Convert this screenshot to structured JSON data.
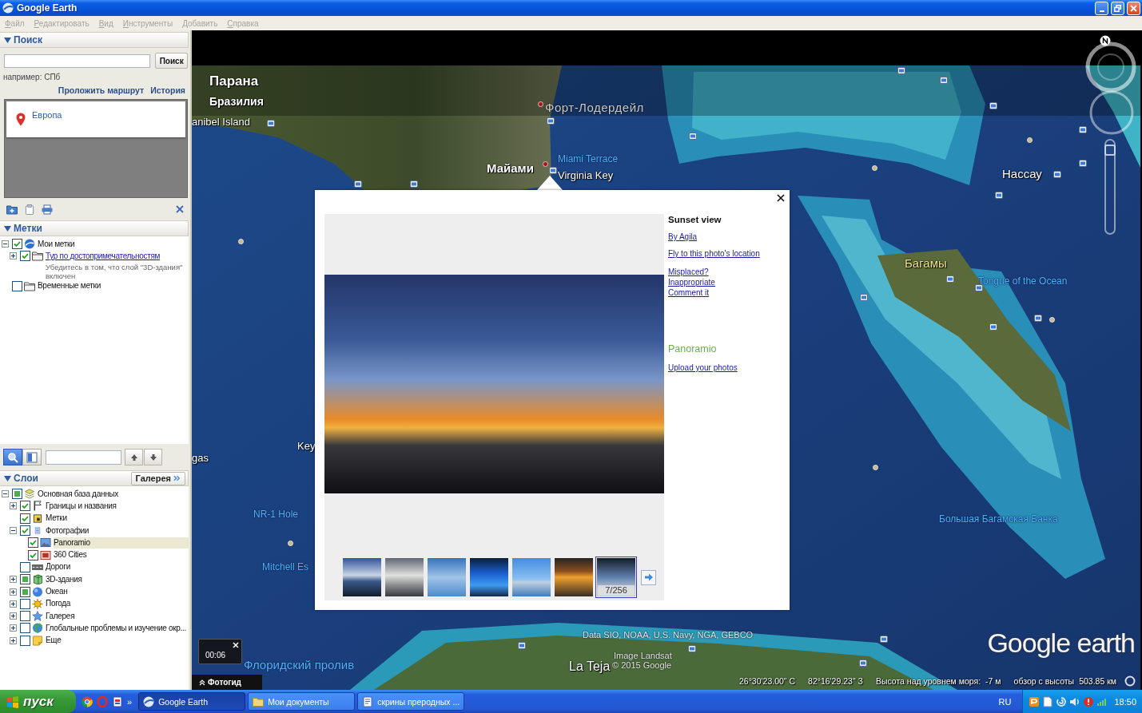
{
  "window": {
    "title": "Google Earth"
  },
  "menu": [
    {
      "label": "Файл",
      "disabled": true
    },
    {
      "label": "Редактировать",
      "disabled": true
    },
    {
      "label": "Вид",
      "disabled": true
    },
    {
      "label": "Инструменты",
      "disabled": true
    },
    {
      "label": "Добавить",
      "disabled": true
    },
    {
      "label": "Справка",
      "disabled": true
    }
  ],
  "search": {
    "title": "Поиск",
    "expanded": true,
    "button": "Поиск",
    "hint": "например: СПб",
    "links": [
      "Проложить маршрут",
      "История"
    ],
    "results": [
      {
        "label": "Европа"
      }
    ]
  },
  "places": {
    "title": "Метки",
    "expanded": true,
    "tree": [
      {
        "label": "Мои метки",
        "kind": "globe",
        "checked": true,
        "partial": false,
        "expandable": true,
        "expanded": true,
        "link": false,
        "selected": false,
        "children": [
          {
            "label": "Тур по достопримечательностям",
            "kind": "folder",
            "checked": true,
            "partial": false,
            "expandable": true,
            "expanded": false,
            "link": true,
            "selected": false,
            "description": "Убедитесь в том, что слой \"3D-здания\" включен"
          }
        ]
      },
      {
        "label": "Временные метки",
        "kind": "folder",
        "checked": false,
        "partial": false,
        "expandable": false,
        "link": false,
        "selected": false
      }
    ]
  },
  "layers": {
    "title": "Слои",
    "expanded": true,
    "gallery_button": "Галерея",
    "search_modes": [
      {
        "selected": true
      },
      {
        "selected": false
      }
    ],
    "tree": [
      {
        "label": "Основная база данных",
        "kind": "database",
        "checked": false,
        "partial": true,
        "expandable": true,
        "expanded": true,
        "link": false,
        "selected": false,
        "children": [
          {
            "label": "Границы и названия",
            "kind": "borders",
            "checked": true,
            "partial": false,
            "expandable": true,
            "expanded": false,
            "link": false,
            "selected": false
          },
          {
            "label": "Метки",
            "kind": "placemarks",
            "checked": true,
            "partial": false,
            "expandable": false,
            "link": false,
            "selected": false
          },
          {
            "label": "Фотографии",
            "kind": "photos",
            "checked": true,
            "partial": false,
            "expandable": true,
            "expanded": true,
            "link": false,
            "selected": false,
            "children": [
              {
                "label": "Panoramio",
                "kind": "panoramio",
                "checked": true,
                "partial": false,
                "expandable": false,
                "link": false,
                "selected": true
              },
              {
                "label": "360 Cities",
                "kind": "cities",
                "checked": true,
                "partial": false,
                "expandable": false,
                "link": false,
                "selected": false
              }
            ]
          },
          {
            "label": "Дороги",
            "kind": "roads",
            "checked": false,
            "partial": false,
            "expandable": false,
            "link": false,
            "selected": false
          },
          {
            "label": "3D-здания",
            "kind": "buildings",
            "checked": false,
            "partial": true,
            "expandable": true,
            "expanded": false,
            "link": false,
            "selected": false
          },
          {
            "label": "Океан",
            "kind": "ocean",
            "checked": false,
            "partial": true,
            "expandable": true,
            "expanded": false,
            "link": false,
            "selected": false
          },
          {
            "label": "Погода",
            "kind": "weather",
            "checked": false,
            "partial": false,
            "expandable": true,
            "expanded": false,
            "link": false,
            "selected": false
          },
          {
            "label": "Галерея",
            "kind": "gallery",
            "checked": false,
            "partial": false,
            "expandable": true,
            "expanded": false,
            "link": false,
            "selected": false
          },
          {
            "label": "Глобальные проблемы и изучение окр...",
            "kind": "global",
            "checked": false,
            "partial": false,
            "expandable": true,
            "expanded": false,
            "link": false,
            "selected": false
          },
          {
            "label": "Еще",
            "kind": "more",
            "checked": false,
            "partial": false,
            "expandable": true,
            "expanded": false,
            "link": false,
            "selected": false
          }
        ]
      }
    ]
  },
  "map": {
    "labels": [
      {
        "text": "Парана",
        "kind": "place"
      },
      {
        "text": "Бразилия",
        "kind": "place"
      },
      {
        "text": "anibel Island",
        "kind": "place"
      },
      {
        "text": "Форт-Лодердейл",
        "kind": "dim"
      },
      {
        "text": "Майами",
        "kind": "place"
      },
      {
        "text": "Miami Terrace",
        "kind": "water"
      },
      {
        "text": "Virginia Key",
        "kind": "place"
      },
      {
        "text": "Нассау",
        "kind": "place"
      },
      {
        "text": "Багамы",
        "kind": "country"
      },
      {
        "text": "Tongue of the Ocean",
        "kind": "water"
      },
      {
        "text": "Большая Багамская Банка",
        "kind": "water"
      },
      {
        "text": "Key",
        "kind": "place"
      },
      {
        "text": "gas",
        "kind": "place"
      },
      {
        "text": "NR-1 Hole",
        "kind": "water"
      },
      {
        "text": "Mitchell Es",
        "kind": "water"
      },
      {
        "text": "Флоридский пролив",
        "kind": "water"
      },
      {
        "text": "La Teja",
        "kind": "place"
      }
    ],
    "attribution": [
      "Data SIO, NOAA, U.S. Navy, NGA, GEBCO",
      "Image Landsat",
      "© 2015 Google"
    ],
    "logo": "Google earth",
    "status": [
      "26°30'23.00\" С",
      "82°16'29.23\" З",
      "Высота над уровнем моря:",
      "-7 м",
      "обзор с высоты",
      "503.85 км"
    ],
    "zoom": {
      "level": 0.95
    },
    "tour": {
      "time": "00:06"
    },
    "photo_guide": "Фотогид"
  },
  "popup": {
    "title": "Sunset view",
    "author": "By Agila",
    "fly_to": "Fly to this photo's location",
    "report": [
      "Misplaced?",
      "Inappropriate",
      "Comment it"
    ],
    "brand": "Panoramio",
    "upload": "Upload your photos",
    "thumbnails": [
      {
        "selected": false
      },
      {
        "selected": false
      },
      {
        "selected": false
      },
      {
        "selected": false
      },
      {
        "selected": false
      },
      {
        "selected": false
      },
      {
        "selected": true,
        "counter": "7/256"
      }
    ]
  },
  "taskbar": {
    "start": "пуск",
    "more": "»",
    "tasks": [
      {
        "label": "Google Earth",
        "selected": true
      },
      {
        "label": "Мои документы",
        "selected": false
      },
      {
        "label": "скрины преродных ...",
        "selected": false
      }
    ],
    "language": "RU",
    "clock": "18:50"
  }
}
